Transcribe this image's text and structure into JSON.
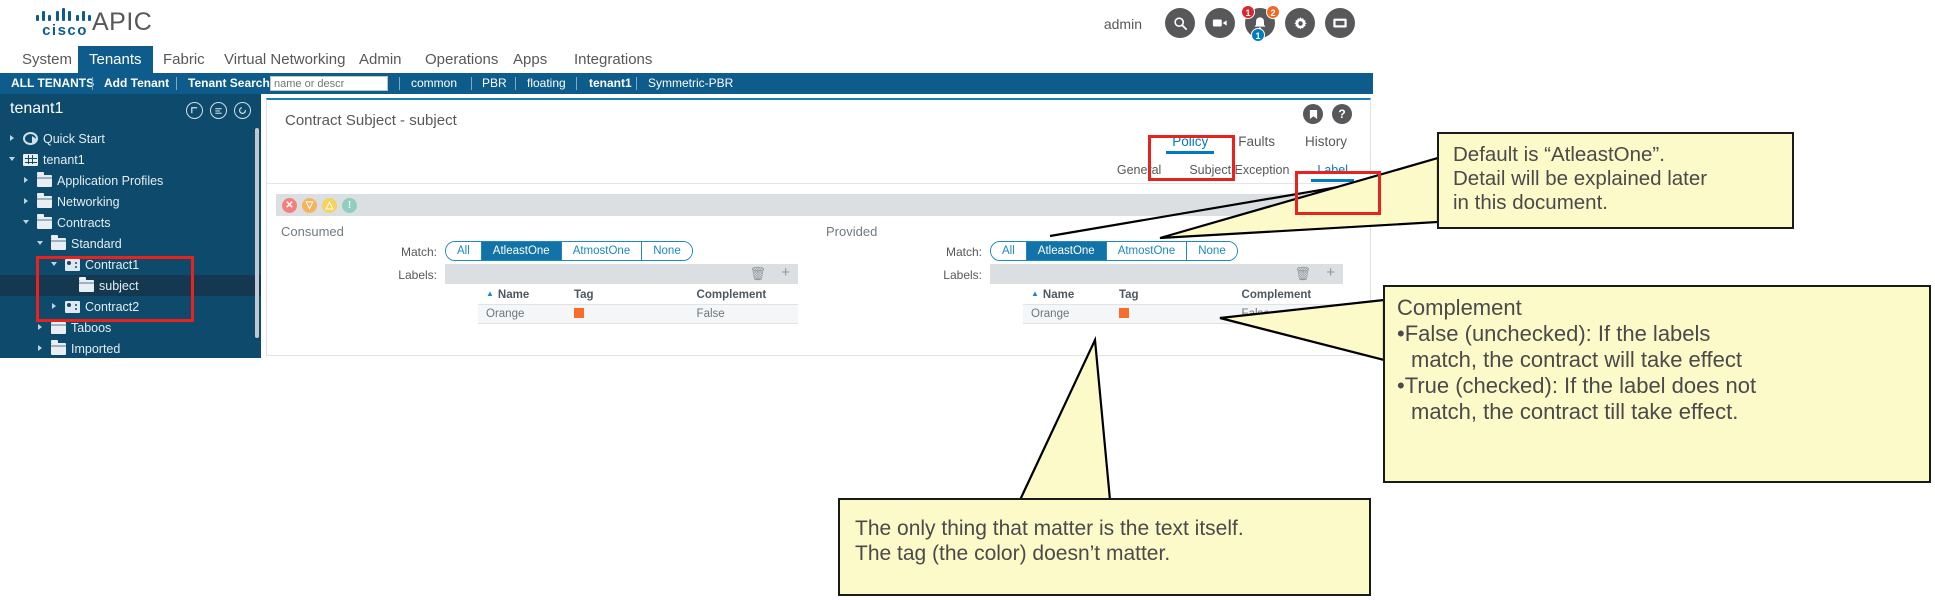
{
  "header": {
    "brand": "cisco",
    "product": "APIC",
    "user": "admin",
    "icons": [
      {
        "name": "search-icon",
        "badges": []
      },
      {
        "name": "video-icon",
        "badges": []
      },
      {
        "name": "alerts-bell-icon",
        "badges": [
          {
            "value": "1",
            "color": "#d9272d"
          },
          {
            "value": "2",
            "color": "#f26724"
          },
          {
            "value": "1",
            "color": "#007ac0"
          }
        ]
      },
      {
        "name": "gear-icon",
        "badges": []
      },
      {
        "name": "feedback-icon",
        "badges": []
      }
    ]
  },
  "mainnav": {
    "items": [
      {
        "label": "System",
        "active": false
      },
      {
        "label": "Tenants",
        "active": true
      },
      {
        "label": "Fabric",
        "active": false
      },
      {
        "label": "Virtual Networking",
        "active": false
      },
      {
        "label": "Admin",
        "active": false
      },
      {
        "label": "Operations",
        "active": false
      },
      {
        "label": "Apps",
        "active": false
      },
      {
        "label": "Integrations",
        "active": false
      }
    ]
  },
  "subnav": {
    "all_tenants": "ALL TENANTS",
    "add_tenant": "Add Tenant",
    "search_label": "Tenant Search:",
    "search_placeholder": "name or descr",
    "search_value": "",
    "links": [
      {
        "label": "common",
        "bold": false
      },
      {
        "label": "PBR",
        "bold": false
      },
      {
        "label": "floating",
        "bold": false
      },
      {
        "label": "tenant1",
        "bold": true
      },
      {
        "label": "Symmetric-PBR",
        "bold": false
      }
    ]
  },
  "tree": {
    "title": "tenant1",
    "head_icons": [
      "collapse-icon",
      "list-icon",
      "refresh-icon"
    ],
    "items": [
      {
        "label": "Quick Start",
        "indent": 0,
        "chevron": "right",
        "icon": "quick",
        "selected": false
      },
      {
        "label": "tenant1",
        "indent": 0,
        "chevron": "down",
        "icon": "grid",
        "selected": false
      },
      {
        "label": "Application Profiles",
        "indent": 1,
        "chevron": "right",
        "icon": "folder",
        "selected": false
      },
      {
        "label": "Networking",
        "indent": 1,
        "chevron": "right",
        "icon": "folder",
        "selected": false
      },
      {
        "label": "Contracts",
        "indent": 1,
        "chevron": "down",
        "icon": "folder",
        "selected": false
      },
      {
        "label": "Standard",
        "indent": 2,
        "chevron": "down",
        "icon": "folder",
        "selected": false
      },
      {
        "label": "Contract1",
        "indent": 3,
        "chevron": "down",
        "icon": "contract",
        "selected": false
      },
      {
        "label": "subject",
        "indent": 4,
        "chevron": "none",
        "icon": "folder",
        "selected": true
      },
      {
        "label": "Contract2",
        "indent": 3,
        "chevron": "right",
        "icon": "contract",
        "selected": false
      },
      {
        "label": "Taboos",
        "indent": 2,
        "chevron": "right",
        "icon": "folder",
        "selected": false
      },
      {
        "label": "Imported",
        "indent": 2,
        "chevron": "right",
        "icon": "folder",
        "selected": false
      }
    ]
  },
  "content": {
    "page_title": "Contract Subject - subject",
    "corner_icons": [
      "bookmark-icon",
      "help-icon"
    ],
    "tabs": [
      {
        "label": "Policy",
        "active": true
      },
      {
        "label": "Faults",
        "active": false
      },
      {
        "label": "History",
        "active": false
      }
    ],
    "subtabs": [
      {
        "label": "General",
        "active": false
      },
      {
        "label": "Subject Exception",
        "active": false
      },
      {
        "label": "Label",
        "active": true
      }
    ],
    "statusbar": {
      "indicators": [
        {
          "name": "critical-fault-icon",
          "color": "#f2817e",
          "glyph": "✕"
        },
        {
          "name": "major-fault-icon",
          "color": "#f5b45c",
          "glyph": "▽"
        },
        {
          "name": "minor-fault-icon",
          "color": "#f4d45c",
          "glyph": "△"
        },
        {
          "name": "warning-fault-icon",
          "color": "#8ed0bc",
          "glyph": "!"
        }
      ],
      "tools": [
        {
          "name": "refresh-icon",
          "glyph": "↻"
        },
        {
          "name": "download-icon",
          "glyph": "⤓"
        },
        {
          "name": "settings-icon",
          "glyph": "⚙"
        }
      ]
    },
    "panes": [
      {
        "title": "Consumed",
        "match_label": "Match:",
        "labels_label": "Labels:",
        "match_options": [
          {
            "label": "All",
            "active": false
          },
          {
            "label": "AtleastOne",
            "active": true
          },
          {
            "label": "AtmostOne",
            "active": false
          },
          {
            "label": "None",
            "active": false
          }
        ],
        "toolbar_icons": [
          "trash-icon",
          "add-icon"
        ],
        "table": {
          "columns": [
            "Name",
            "Tag",
            "Complement"
          ],
          "sorted_column": "Name",
          "rows": [
            {
              "name": "Orange",
              "tag_color": "#f96d2a",
              "complement": "False"
            }
          ]
        }
      },
      {
        "title": "Provided",
        "match_label": "Match:",
        "labels_label": "Labels:",
        "match_options": [
          {
            "label": "All",
            "active": false
          },
          {
            "label": "AtleastOne",
            "active": true
          },
          {
            "label": "AtmostOne",
            "active": false
          },
          {
            "label": "None",
            "active": false
          }
        ],
        "toolbar_icons": [
          "trash-icon",
          "add-icon"
        ],
        "table": {
          "columns": [
            "Name",
            "Tag",
            "Complement"
          ],
          "sorted_column": "Name",
          "rows": [
            {
              "name": "Orange",
              "tag_color": "#f96d2a",
              "complement": "False"
            }
          ]
        }
      }
    ]
  },
  "annotations": {
    "callout_default": {
      "lines": [
        "Default is “AtleastOne”.",
        "Detail will be explained later",
        "in this document."
      ]
    },
    "callout_complement": {
      "lines": [
        "Complement",
        "•False (unchecked): If the labels",
        "  match, the contract will take effect",
        "•True (checked): If the label does not",
        "  match, the contract till take effect."
      ]
    },
    "callout_tag": {
      "lines": [
        "The only thing that matter is the text itself.",
        "The tag (the color) doesn’t matter."
      ]
    },
    "highlight_color": "#e8231e"
  }
}
